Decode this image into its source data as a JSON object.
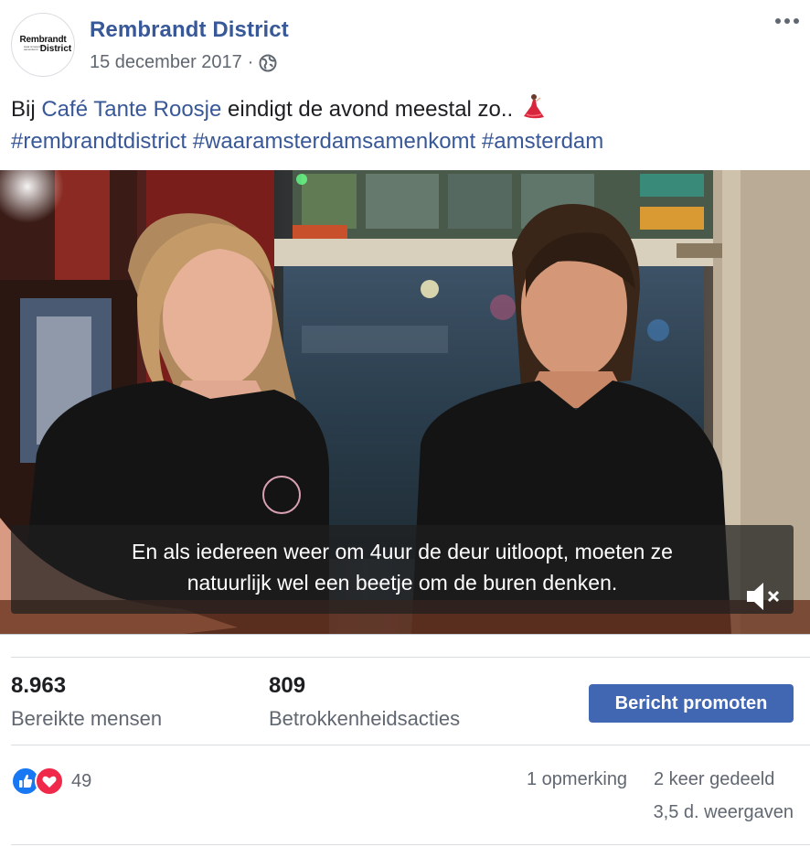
{
  "header": {
    "page_name": "Rembrandt District",
    "date": "15 december 2017",
    "separator": "·",
    "avatar_line1": "Rembrandt",
    "avatar_line2": "waar Amsterdam samenkomt",
    "avatar_line3": "District",
    "privacy_icon": "globe-icon",
    "menu_icon": "more-options-icon"
  },
  "post": {
    "text_prefix": "Bij ",
    "link_text": "Café Tante Roosje",
    "text_suffix": " eindigt de avond meestal zo.. ",
    "emoji_icon": "flamenco-dancer-icon",
    "hashtag_1": "#rembrandtdistrict",
    "hashtag_2": "#waaramsterdamsamenkomt",
    "hashtag_3": "#amsterdam"
  },
  "video": {
    "subtitle_line1": "En als iedereen weer om 4uur de deur uitloopt, moeten ze",
    "subtitle_line2": "natuurlijk wel een beetje om de buren denken.",
    "mute_icon": "muted-speaker-icon",
    "shirt_logo_text": "Café Tante Roosje"
  },
  "stats": {
    "reach_value": "8.963",
    "reach_label": "Bereikte mensen",
    "engagement_value": "809",
    "engagement_label": "Betrokkenheidsacties",
    "promote_label": "Bericht promoten"
  },
  "reactions": {
    "count": "49",
    "like_icon": "like-icon",
    "love_icon": "love-icon",
    "comments": "1 opmerking",
    "shares": "2 keer gedeeld",
    "views": "3,5 d. weergaven"
  },
  "colors": {
    "link": "#385898",
    "button": "#4267b2",
    "like": "#1877f2",
    "love": "#f0284a",
    "secondary_text": "#606770"
  }
}
